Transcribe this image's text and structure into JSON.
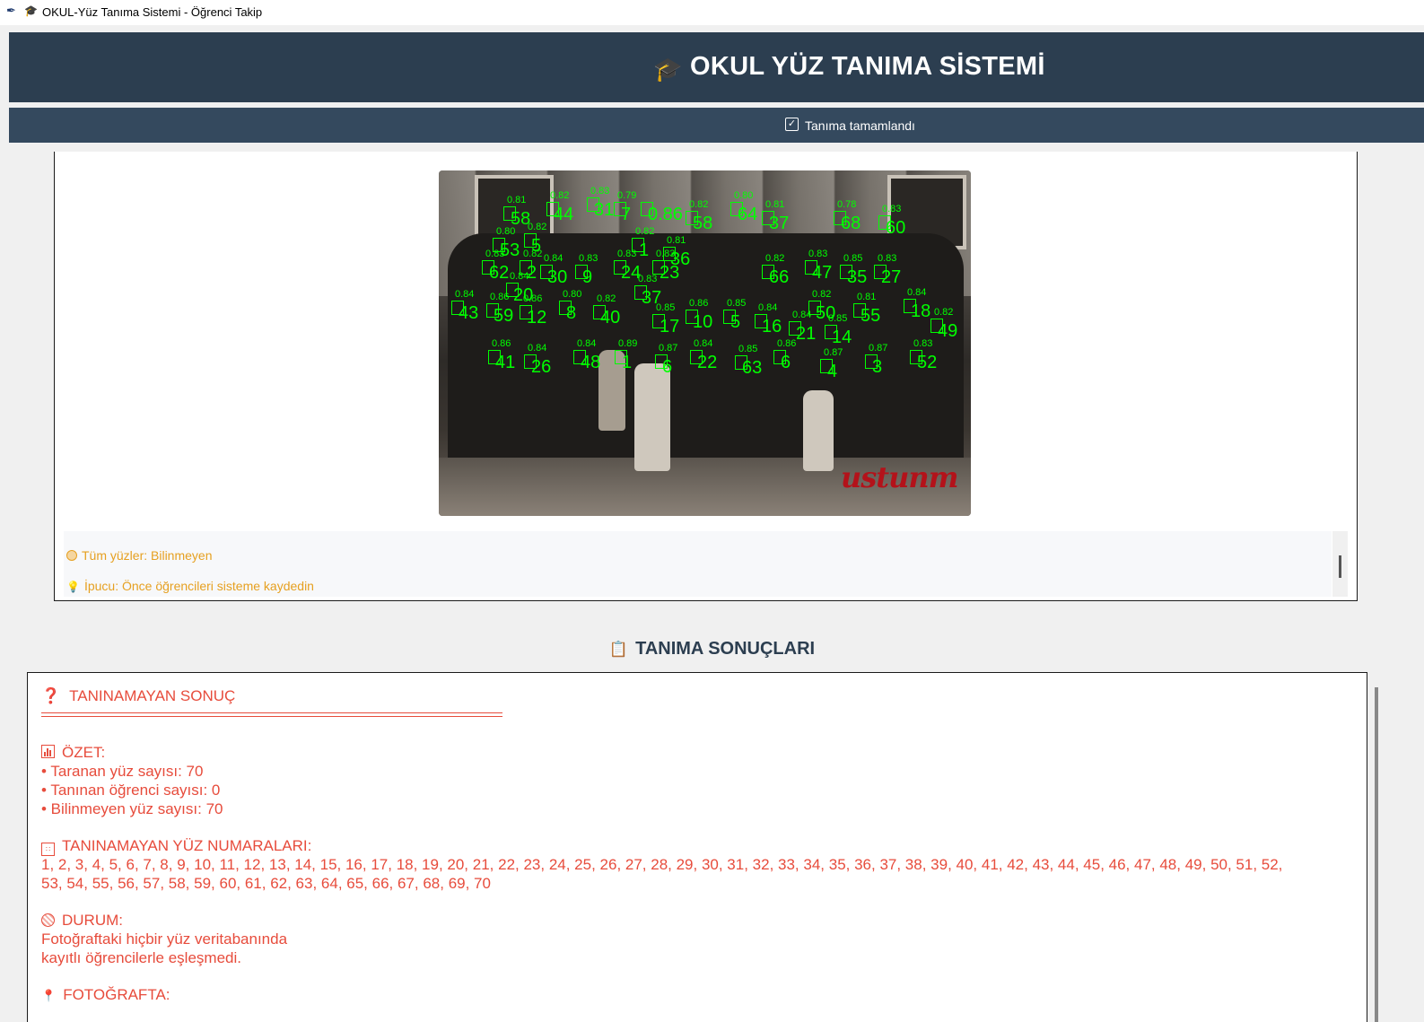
{
  "window": {
    "app_icon": "feather-icon",
    "title_icon": "graduation-cap-icon",
    "title": "OKUL-Yüz Tanıma Sistemi - Öğrenci Takip"
  },
  "header": {
    "icon": "graduation-cap-icon",
    "title": "OKUL YÜZ TANIMA SİSTEMİ",
    "background": "#2c3e50"
  },
  "status": {
    "icon": "checkbox-icon",
    "text": "Tanıma tamamlandı",
    "background": "#34495e"
  },
  "photo": {
    "watermark": "ustunm",
    "box_color": "#00ff00",
    "faces": [
      {
        "n": "58",
        "c": "0.81"
      },
      {
        "n": "44",
        "c": "0.82"
      },
      {
        "n": "31",
        "c": "0.83"
      },
      {
        "n": "7",
        "c": "0.79"
      },
      {
        "n": "0.86",
        "c": ""
      },
      {
        "n": "58",
        "c": "0.82"
      },
      {
        "n": "64",
        "c": "0.80"
      },
      {
        "n": "37",
        "c": "0.81"
      },
      {
        "n": "68",
        "c": "0.78"
      },
      {
        "n": "60",
        "c": "0.83"
      },
      {
        "n": "53",
        "c": "0.80"
      },
      {
        "n": "5",
        "c": "0.82"
      },
      {
        "n": "36",
        "c": "0.81"
      },
      {
        "n": "1",
        "c": "0.82"
      },
      {
        "n": "62",
        "c": "0.83"
      },
      {
        "n": "23",
        "c": "0.83"
      },
      {
        "n": "2",
        "c": "0.82"
      },
      {
        "n": "30",
        "c": "0.84"
      },
      {
        "n": "9",
        "c": "0.83"
      },
      {
        "n": "24",
        "c": "0.83"
      },
      {
        "n": "66",
        "c": "0.82"
      },
      {
        "n": "47",
        "c": "0.83"
      },
      {
        "n": "35",
        "c": "0.85"
      },
      {
        "n": "27",
        "c": "0.83"
      },
      {
        "n": "20",
        "c": "0.84"
      },
      {
        "n": "37",
        "c": "0.83"
      },
      {
        "n": "43",
        "c": "0.84"
      },
      {
        "n": "59",
        "c": "0.86"
      },
      {
        "n": "12",
        "c": "0.86"
      },
      {
        "n": "8",
        "c": "0.80"
      },
      {
        "n": "40",
        "c": "0.82"
      },
      {
        "n": "17",
        "c": "0.85"
      },
      {
        "n": "10",
        "c": "0.86"
      },
      {
        "n": "5",
        "c": "0.85"
      },
      {
        "n": "16",
        "c": "0.84"
      },
      {
        "n": "21",
        "c": "0.84"
      },
      {
        "n": "50",
        "c": "0.82"
      },
      {
        "n": "14",
        "c": "0.85"
      },
      {
        "n": "55",
        "c": "0.81"
      },
      {
        "n": "18",
        "c": "0.84"
      },
      {
        "n": "49",
        "c": "0.82"
      },
      {
        "n": "41",
        "c": "0.86"
      },
      {
        "n": "26",
        "c": "0.84"
      },
      {
        "n": "48",
        "c": "0.84"
      },
      {
        "n": "1",
        "c": "0.89"
      },
      {
        "n": "6",
        "c": "0.87"
      },
      {
        "n": "22",
        "c": "0.84"
      },
      {
        "n": "63",
        "c": "0.85"
      },
      {
        "n": "6",
        "c": "0.86"
      },
      {
        "n": "4",
        "c": "0.87"
      },
      {
        "n": "3",
        "c": "0.87"
      },
      {
        "n": "52",
        "c": "0.83"
      }
    ]
  },
  "info": {
    "line1_icon": "circle-icon",
    "line1": "Tüm yüzler: Bilinmeyen",
    "line2_icon": "lightbulb-icon",
    "line2": "İpucu: Önce öğrencileri sisteme kaydedin"
  },
  "results": {
    "heading_icon": "clipboard-icon",
    "heading": "TANIMA SONUÇLARI",
    "title_icon": "question-icon",
    "title": "TANINAMAYAN SONUÇ",
    "summary_icon": "bar-chart-icon",
    "summary_label": "ÖZET:",
    "summary_lines": [
      "• Taranan yüz sayısı: 70",
      "• Tanınan öğrenci sayısı: 0",
      "• Bilinmeyen yüz sayısı: 70"
    ],
    "numbers_icon": "numbers-icon",
    "numbers_label": "TANINAMAYAN YÜZ NUMARALARI:",
    "numbers_line1": "1, 2, 3, 4, 5, 6, 7, 8, 9, 10, 11, 12, 13, 14, 15, 16, 17, 18, 19, 20, 21, 22, 23, 24, 25, 26, 27, 28, 29, 30, 31, 32, 33, 34, 35, 36, 37, 38, 39, 40, 41, 42, 43, 44, 45, 46, 47, 48, 49, 50, 51, 52,",
    "numbers_line2": "53, 54, 55, 56, 57, 58, 59, 60, 61, 62, 63, 64, 65, 66, 67, 68, 69, 70",
    "status_icon": "circle-icon",
    "status_label": "DURUM:",
    "status_lines": [
      "Fotoğraftaki hiçbir yüz veritabanında",
      "kayıtlı öğrencilerle eşleşmedi."
    ],
    "photo_icon": "pin-icon",
    "photo_label": "FOTOĞRAFTA:",
    "text_color": "#e74c3c"
  }
}
